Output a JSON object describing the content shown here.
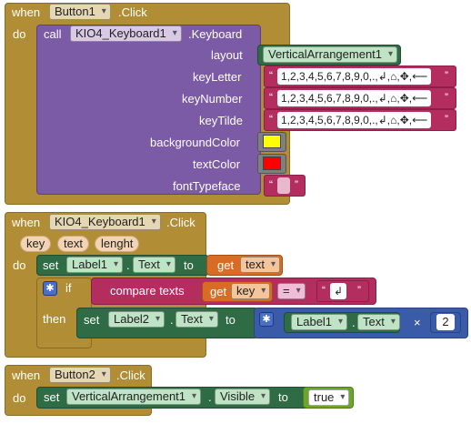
{
  "block1": {
    "when": "when",
    "component": "Button1",
    "event": ".Click",
    "do": "do",
    "call": "call",
    "call_component": "KIO4_Keyboard1",
    "method": ".Keyboard",
    "params": {
      "layout": "layout",
      "keyLetter": "keyLetter",
      "keyNumber": "keyNumber",
      "keyTilde": "keyTilde",
      "backgroundColor": "backgroundColor",
      "textColor": "textColor",
      "fontTypeface": "fontTypeface"
    },
    "layout_value": "VerticalArrangement1",
    "keyLetter_value": "1,2,3,4,5,6,7,8,9,0,.,↲,⌂,✥,⟵",
    "keyNumber_value": "1,2,3,4,5,6,7,8,9,0,.,↲,⌂,✥,⟵",
    "keyTilde_value": "1,2,3,4,5,6,7,8,9,0,.,↲,⌂,✥,⟵",
    "backgroundColor_value": "#ffff00",
    "textColor_value": "#ff0000",
    "fontTypeface_value": "",
    "quote_open": "“",
    "quote_close": "”"
  },
  "block2": {
    "when": "when",
    "component": "KIO4_Keyboard1",
    "event": ".Click",
    "args": [
      "key",
      "text",
      "lenght"
    ],
    "do": "do",
    "set": "set",
    "target1_component": "Label1",
    "target1_prop": "Text",
    "to": "to",
    "get": "get",
    "get_text": "text",
    "if": "if",
    "compare_texts": "compare texts",
    "get_key": "key",
    "op": "=",
    "compare_value": "↲",
    "then": "then",
    "target2_component": "Label2",
    "target2_prop": "Text",
    "join_component": "Label1",
    "join_prop": "Text",
    "times": "×",
    "number": "2"
  },
  "block3": {
    "when": "when",
    "component": "Button2",
    "event": ".Click",
    "do": "do",
    "set": "set",
    "target_component": "VerticalArrangement1",
    "target_prop": "Visible",
    "to": "to",
    "value": "true"
  },
  "colors": {
    "event": "#b18e35",
    "call": "#7b5aa6",
    "text": "#b32d5e",
    "component": "#2f6b44",
    "variable": "#d96c24",
    "math": "#3a5ba8",
    "logic": "#6ba62a"
  }
}
